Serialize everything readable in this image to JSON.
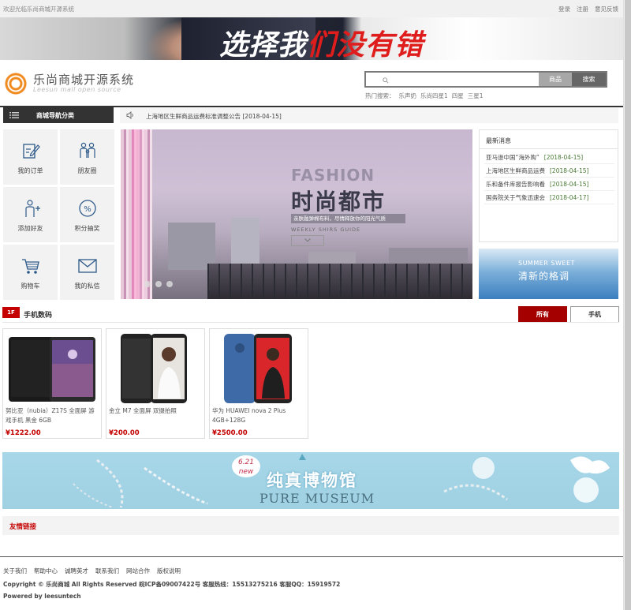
{
  "topbar": {
    "welcome": "欢迎光临乐尚商城开源系统",
    "links": [
      "登录",
      "注册",
      "意见反馈"
    ]
  },
  "banner": {
    "text_white": "选择我",
    "text_red": "们没有错"
  },
  "logo": {
    "title": "乐尚商城开源系统",
    "subtitle": "Leesun mall open source"
  },
  "search": {
    "placeholder": "",
    "tab_label": "商品",
    "button_label": "搜索",
    "hot_label": "热门搜索：",
    "hot_items": [
      "乐声奶",
      "乐尚四星1",
      "四星",
      "三星1"
    ]
  },
  "nav": {
    "category_label": "商城导航分类",
    "notice": "上海地区生鲜商品运费标准调整公告 [2018-04-15]"
  },
  "quick_menu": [
    {
      "label": "我的订单",
      "icon": "order-edit-icon"
    },
    {
      "label": "朋友圈",
      "icon": "friends-icon"
    },
    {
      "label": "添加好友",
      "icon": "add-friend-icon"
    },
    {
      "label": "积分抽奖",
      "icon": "points-lottery-icon"
    },
    {
      "label": "购物车",
      "icon": "cart-icon"
    },
    {
      "label": "我的私信",
      "icon": "mail-icon"
    }
  ],
  "slider": {
    "fashion": "FASHION",
    "title": "时尚都市",
    "caption": "亲肤融弹棉布料，尽情释放你的阳光气质",
    "sub": "WEEKLY SHIRS GUIDE",
    "dots": 3
  },
  "news": {
    "title": "最新消息",
    "items": [
      {
        "text": "亚马逊中国“海外购”",
        "date": "[2018-04-15]"
      },
      {
        "text": "上海地区生鲜商品运费",
        "date": "[2018-04-15]"
      },
      {
        "text": "乐和备件库报告影响看",
        "date": "[2018-04-15]"
      },
      {
        "text": "国务院关于气象迅速会",
        "date": "[2018-04-17]"
      }
    ]
  },
  "summer_banner": {
    "en": "SUMMER SWEET",
    "cn": "清新的格调"
  },
  "floor": {
    "badge": "1F",
    "title": "手机数码",
    "filters": [
      "所有",
      "手机"
    ]
  },
  "products": [
    {
      "name": "努比亚（nubia）Z17S 全面屏 游戏手机 黑金 6GB",
      "price": "¥1222.00"
    },
    {
      "name": "金立 M7 全面屏 双摄拍照",
      "price": "¥200.00"
    },
    {
      "name": "华为 HUAWEI nova 2 Plus 4GB+128G",
      "price": "¥2500.00"
    }
  ],
  "museum_banner": {
    "badge_num": "6.21",
    "badge_new": "new",
    "cn": "纯真博物馆",
    "en": "PURE MUSEUM"
  },
  "friend_links": {
    "title": "友情链接"
  },
  "footer": {
    "links": [
      "关于我们",
      "帮助中心",
      "诚聘英才",
      "联系我们",
      "网站合作",
      "版权说明"
    ],
    "copyright": "Copyright © 乐尚商城 All Rights Reserved 皖ICP备09007422号  客服热线：15513275216  客服QQ：15919572",
    "powered": "Powered by leesuntech"
  },
  "colors": {
    "accent_red": "#c40000",
    "dark_nav": "#333333",
    "news_date": "#4a7a35",
    "logo_orange": "#f08a1f"
  }
}
